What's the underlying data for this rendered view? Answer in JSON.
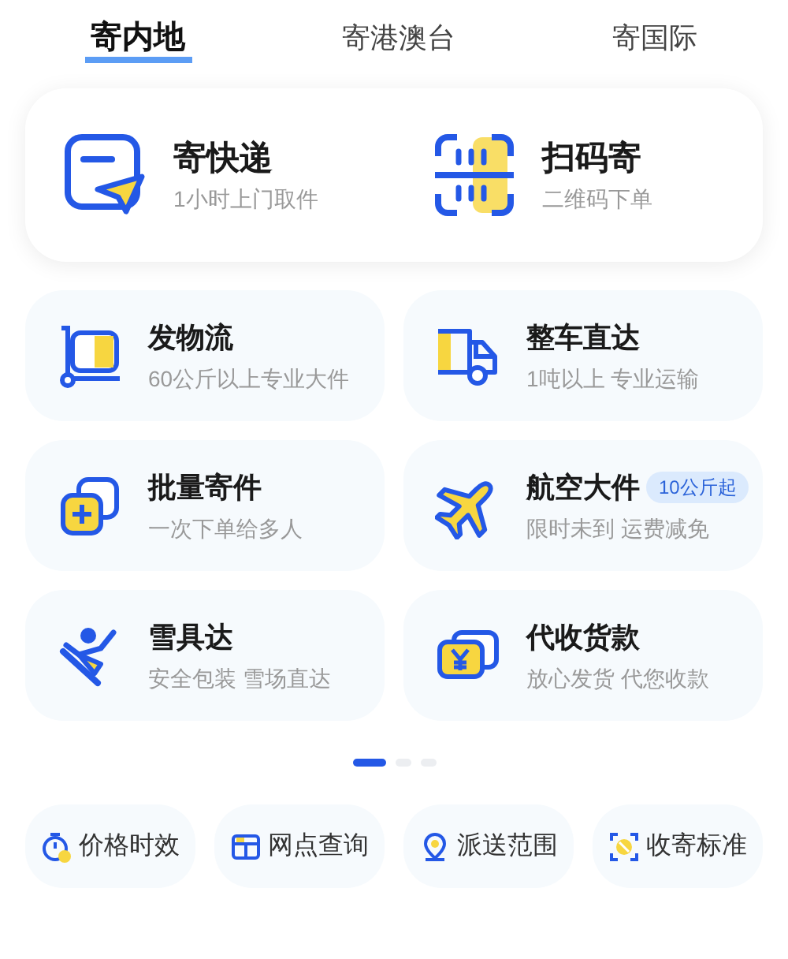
{
  "tabs": [
    {
      "label": "寄内地",
      "selected": true
    },
    {
      "label": "寄港澳台",
      "selected": false
    },
    {
      "label": "寄国际",
      "selected": false
    }
  ],
  "main_actions": [
    {
      "title": "寄快递",
      "subtitle": "1小时上门取件"
    },
    {
      "title": "扫码寄",
      "subtitle": "二维码下单"
    }
  ],
  "services": [
    {
      "title": "发物流",
      "subtitle": "60公斤以上专业大件"
    },
    {
      "title": "整车直达",
      "subtitle": "1吨以上 专业运输"
    },
    {
      "title": "批量寄件",
      "subtitle": "一次下单给多人"
    },
    {
      "title": "航空大件",
      "subtitle": "限时未到 运费减免",
      "badge": "10公斤起"
    },
    {
      "title": "雪具达",
      "subtitle": "安全包装 雪场直达"
    },
    {
      "title": "代收货款",
      "subtitle": "放心发货 代您收款"
    }
  ],
  "pager": [
    {
      "selected": true
    },
    {
      "selected": false
    },
    {
      "selected": false
    }
  ],
  "shortcuts": [
    "价格时效",
    "网点查询",
    "派送范围",
    "收寄标准"
  ]
}
